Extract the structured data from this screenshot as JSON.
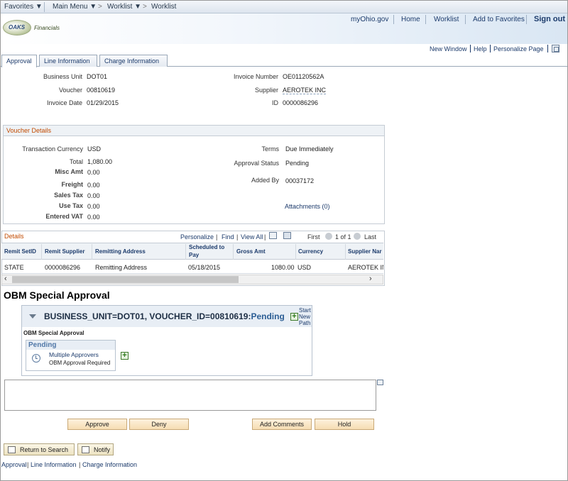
{
  "topnav": {
    "favorites": "Favorites",
    "main_menu": "Main Menu",
    "crumb1": "Worklist",
    "crumb2": "Worklist"
  },
  "banner": {
    "logo_text": "OAKS",
    "logo_sub": "Financials",
    "links": [
      "myOhio.gov",
      "Home",
      "Worklist",
      "Add to Favorites"
    ],
    "signout": "Sign out"
  },
  "utility_links": [
    "New Window",
    "Help",
    "Personalize Page"
  ],
  "tabs": [
    "Approval",
    "Line Information",
    "Charge Information"
  ],
  "header": {
    "business_unit_label": "Business Unit",
    "business_unit": "DOT01",
    "voucher_label": "Voucher",
    "voucher": "00810619",
    "invoice_date_label": "Invoice Date",
    "invoice_date": "01/29/2015",
    "invoice_number_label": "Invoice Number",
    "invoice_number": "OE01120562A",
    "supplier_label": "Supplier",
    "supplier": "AEROTEK INC",
    "id_label": "ID",
    "id": "0000086296"
  },
  "voucher_details": {
    "title": "Voucher Details",
    "transaction_currency_label": "Transaction Currency",
    "transaction_currency": "USD",
    "total_label": "Total",
    "total": "1,080.00",
    "misc_amt_label": "Misc Amt",
    "misc_amt": "0.00",
    "freight_label": "Freight",
    "freight": "0.00",
    "sales_tax_label": "Sales Tax",
    "sales_tax": "0.00",
    "use_tax_label": "Use Tax",
    "use_tax": "0.00",
    "entered_vat_label": "Entered VAT",
    "entered_vat": "0.00",
    "terms_label": "Terms",
    "terms": "Due Immediately",
    "approval_status_label": "Approval Status",
    "approval_status": "Pending",
    "added_by_label": "Added By",
    "added_by": "00037172",
    "attachments": "Attachments (0)"
  },
  "details": {
    "title": "Details",
    "personalize": "Personalize",
    "find": "Find",
    "view_all": "View All",
    "first": "First",
    "range": "1 of 1",
    "last": "Last",
    "columns": [
      "Remit SetID",
      "Remit Supplier",
      "Remitting Address",
      "Scheduled to",
      "Pay",
      "Gross Amt",
      "Currency",
      "Supplier Nar"
    ],
    "row": {
      "setid": "STATE",
      "supplier": "0000086296",
      "address": "Remitting Address",
      "scheduled": "05/18/2015",
      "gross": "1080.00",
      "currency": "USD",
      "supplier_name": "AEROTEK IN"
    }
  },
  "obm": {
    "title": "OBM Special Approval",
    "bu_line": "BUSINESS_UNIT=DOT01, VOUCHER_ID=00810619:",
    "status": "Pending",
    "start_path": [
      "Start",
      "New",
      "Path"
    ],
    "subtitle": "OBM Special Approval",
    "stage_status": "Pending",
    "approvers": "Multiple Approvers",
    "required": "OBM Approval Required"
  },
  "actions": {
    "approve": "Approve",
    "deny": "Deny",
    "add_comments": "Add Comments",
    "hold": "Hold",
    "return_to_search": "Return to Search",
    "notify": "Notify"
  },
  "footer_links": [
    "Approval",
    "Line Information",
    "Charge Information"
  ]
}
